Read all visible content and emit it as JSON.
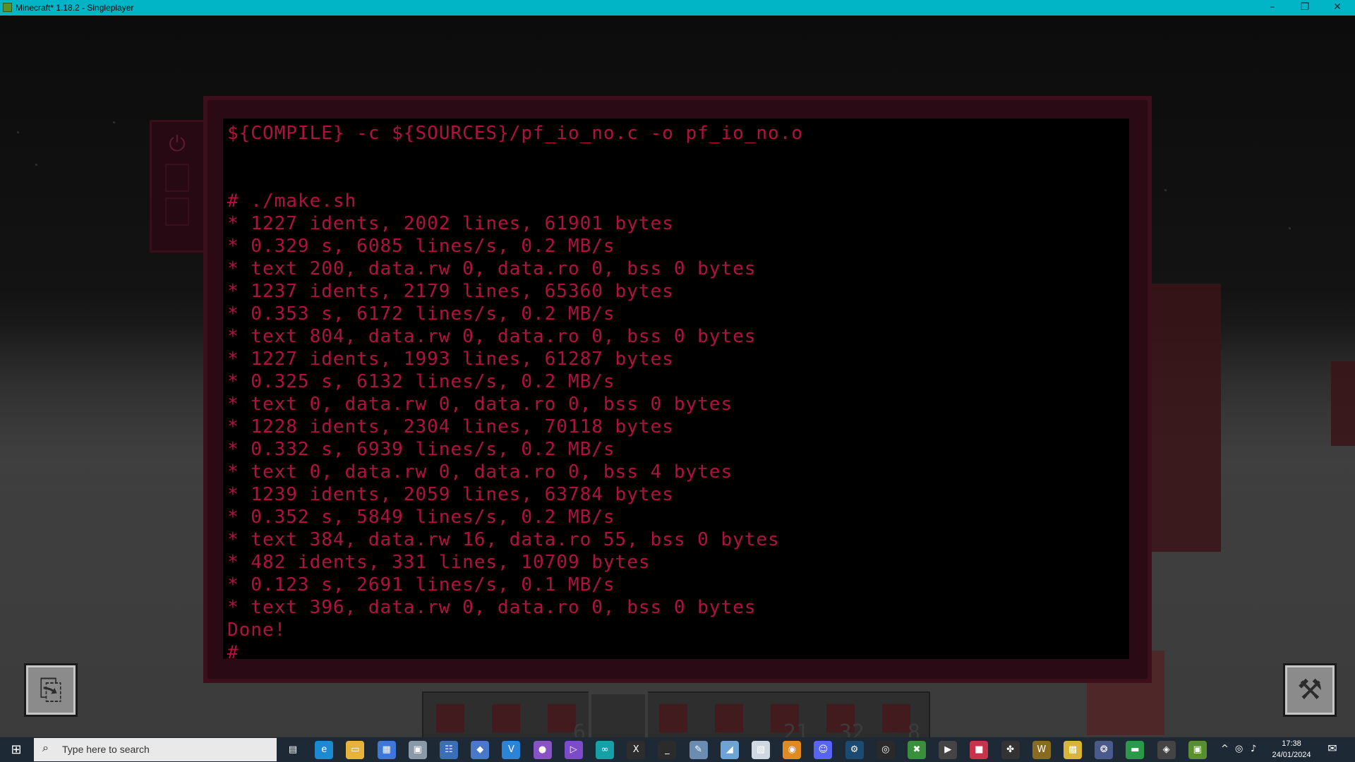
{
  "window": {
    "title": "Minecraft* 1.18.2 - Singleplayer",
    "minimize_glyph": "–",
    "maximize_glyph": "❐",
    "close_glyph": "✕"
  },
  "terminal": {
    "lines": [
      "${COMPILE} -c ${SOURCES}/pf_io_no.c -o pf_io_no.o",
      "",
      "",
      "# ./make.sh",
      "* 1227 idents, 2002 lines, 61901 bytes",
      "* 0.329 s, 6085 lines/s, 0.2 MB/s",
      "* text 200, data.rw 0, data.ro 0, bss 0 bytes",
      "* 1237 idents, 2179 lines, 65360 bytes",
      "* 0.353 s, 6172 lines/s, 0.2 MB/s",
      "* text 804, data.rw 0, data.ro 0, bss 0 bytes",
      "* 1227 idents, 1993 lines, 61287 bytes",
      "* 0.325 s, 6132 lines/s, 0.2 MB/s",
      "* text 0, data.rw 0, data.ro 0, bss 0 bytes",
      "* 1228 idents, 2304 lines, 70118 bytes",
      "* 0.332 s, 6939 lines/s, 0.2 MB/s",
      "* text 0, data.rw 0, data.ro 0, bss 4 bytes",
      "* 1239 idents, 2059 lines, 63784 bytes",
      "* 0.352 s, 5849 lines/s, 0.2 MB/s",
      "* text 384, data.rw 16, data.ro 55, bss 0 bytes",
      "* 482 idents, 331 lines, 10709 bytes",
      "* 0.123 s, 2691 lines/s, 0.1 MB/s",
      "* text 396, data.rw 0, data.ro 0, bss 0 bytes",
      "Done!",
      "#"
    ],
    "text_color": "#b3103f"
  },
  "screen_side": {
    "power_glyph": "⏻"
  },
  "hotbar": {
    "selected_index": 3,
    "slots": [
      {
        "count": ""
      },
      {
        "count": ""
      },
      {
        "count": "6"
      },
      {
        "count": ""
      },
      {
        "count": ""
      },
      {
        "count": ""
      },
      {
        "count": "21"
      },
      {
        "count": "32"
      },
      {
        "count": "8"
      }
    ]
  },
  "corner_buttons": {
    "left_icon": "book-icon",
    "left_glyph": "⎘",
    "right_icon": "wrench-icon",
    "right_glyph": "⚒"
  },
  "taskbar": {
    "start_glyph": "⊞",
    "search_glyph": "⌕",
    "search_placeholder": "Type here to search",
    "time": "17:38",
    "date": "24/01/2024",
    "notification_glyph": "✉",
    "tray_chevron": "^",
    "tray_network": "◎",
    "tray_volume": "♪",
    "apps": [
      {
        "name": "task-view",
        "glyph": "▤",
        "color": "#1d2a36"
      },
      {
        "name": "edge",
        "glyph": "e",
        "color": "#1b8ad3"
      },
      {
        "name": "file-explorer",
        "glyph": "▭",
        "color": "#e8b33a"
      },
      {
        "name": "store",
        "glyph": "▦",
        "color": "#3b78d8"
      },
      {
        "name": "app-gray",
        "glyph": "▣",
        "color": "#8a9aa8"
      },
      {
        "name": "network-tool",
        "glyph": "☷",
        "color": "#3a6fb8"
      },
      {
        "name": "app-blue",
        "glyph": "◆",
        "color": "#4a78c8"
      },
      {
        "name": "vscode-like",
        "glyph": "V",
        "color": "#2b84d6"
      },
      {
        "name": "github",
        "glyph": "●",
        "color": "#8a52c7"
      },
      {
        "name": "visual-studio",
        "glyph": "▷",
        "color": "#7c4bc9"
      },
      {
        "name": "arduino",
        "glyph": "∞",
        "color": "#16a0a8"
      },
      {
        "name": "app-x",
        "glyph": "X",
        "color": "#2d2d2d"
      },
      {
        "name": "terminal",
        "glyph": "_",
        "color": "#2b2b2b"
      },
      {
        "name": "app-brush",
        "glyph": "✎",
        "color": "#6b8db2"
      },
      {
        "name": "app-leaf",
        "glyph": "◢",
        "color": "#6fa3d6"
      },
      {
        "name": "app-doc",
        "glyph": "▧",
        "color": "#cfd8e0"
      },
      {
        "name": "blender",
        "glyph": "◉",
        "color": "#e08a22"
      },
      {
        "name": "discord",
        "glyph": "☺",
        "color": "#5865f2"
      },
      {
        "name": "steam",
        "glyph": "⚙",
        "color": "#1b4b73"
      },
      {
        "name": "obs",
        "glyph": "◎",
        "color": "#2a2a2a"
      },
      {
        "name": "xbox",
        "glyph": "✖",
        "color": "#3a8f3a"
      },
      {
        "name": "app-tool",
        "glyph": "▶",
        "color": "#444"
      },
      {
        "name": "app-red",
        "glyph": "■",
        "color": "#c8334a"
      },
      {
        "name": "app-fly",
        "glyph": "✤",
        "color": "#333"
      },
      {
        "name": "warcraft",
        "glyph": "W",
        "color": "#8a6a1e"
      },
      {
        "name": "app-yellow",
        "glyph": "▩",
        "color": "#d8b43a"
      },
      {
        "name": "app-colorful",
        "glyph": "❂",
        "color": "#4b5a8c"
      },
      {
        "name": "chat",
        "glyph": "▬",
        "color": "#2a9a4a"
      },
      {
        "name": "unity",
        "glyph": "◈",
        "color": "#444"
      },
      {
        "name": "minecraft",
        "glyph": "▣",
        "color": "#5a8f2e"
      }
    ]
  }
}
